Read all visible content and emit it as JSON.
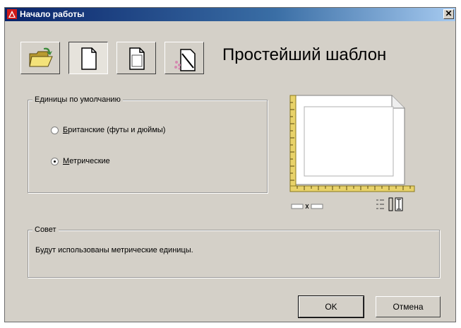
{
  "window": {
    "title": "Начало работы",
    "close_symbol": "✕"
  },
  "toolbar": {
    "buttons": [
      {
        "name": "open-drawing",
        "icon": "folder-open-icon",
        "pressed": false
      },
      {
        "name": "start-from-scratch",
        "icon": "blank-page-icon",
        "pressed": true
      },
      {
        "name": "use-template",
        "icon": "template-page-icon",
        "pressed": false
      },
      {
        "name": "use-wizard",
        "icon": "wizard-icon",
        "pressed": false
      }
    ]
  },
  "main": {
    "template_title": "Простейший шаблон"
  },
  "units": {
    "legend": "Единицы по умолчанию",
    "options": [
      {
        "label": "Британские (футы и дюймы)",
        "mnemonic": "Б",
        "rest": "ританские (футы и дюймы)",
        "checked": false
      },
      {
        "label": "Метрические",
        "mnemonic": "М",
        "rest": "етрические",
        "checked": true
      }
    ]
  },
  "tip": {
    "legend": "Совет",
    "text": "Будут использованы метрические единицы."
  },
  "buttons": {
    "ok": "OK",
    "cancel": "Отмена"
  },
  "colors": {
    "dialog_bg": "#d4d0c8",
    "title_bar": "#0a246a",
    "ruler": "#e8d26a",
    "logo": "#d11a1a"
  }
}
